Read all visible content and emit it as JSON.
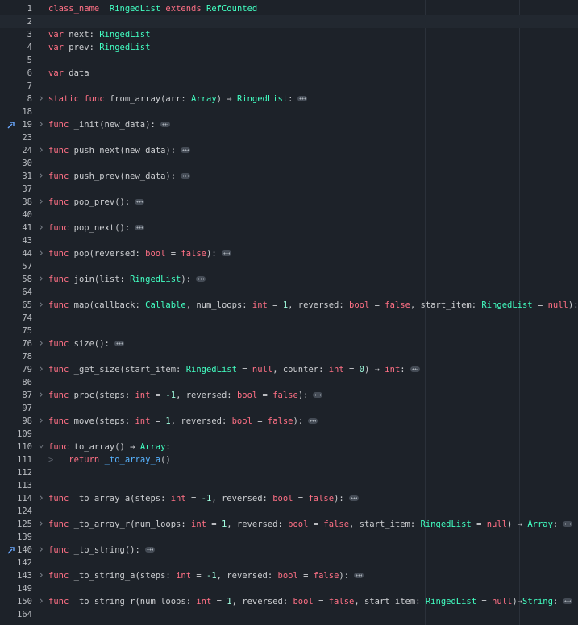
{
  "editor": {
    "colors": {
      "background": "#1d2229",
      "keyword": "#ff7085",
      "type": "#42ffc2",
      "line_number": "#b9bcc1",
      "function_call": "#57b3ff",
      "current_line": "#222830"
    },
    "lines": [
      {
        "n": "1",
        "segs": [
          [
            "class_name",
            "kw"
          ],
          [
            "  ",
            "plain"
          ],
          [
            "RingedList",
            "type"
          ],
          [
            " ",
            "plain"
          ],
          [
            "extends",
            "kw"
          ],
          [
            " ",
            "plain"
          ],
          [
            "RefCounted",
            "type"
          ]
        ]
      },
      {
        "n": "2",
        "segs": [],
        "current": true
      },
      {
        "n": "3",
        "segs": [
          [
            "var",
            "kw"
          ],
          [
            " next: ",
            "plain"
          ],
          [
            "RingedList",
            "type"
          ]
        ]
      },
      {
        "n": "4",
        "segs": [
          [
            "var",
            "kw"
          ],
          [
            " prev: ",
            "plain"
          ],
          [
            "RingedList",
            "type"
          ]
        ]
      },
      {
        "n": "5",
        "segs": []
      },
      {
        "n": "6",
        "segs": [
          [
            "var",
            "kw"
          ],
          [
            " data",
            "plain"
          ]
        ]
      },
      {
        "n": "7",
        "segs": []
      },
      {
        "n": "8",
        "fold": "closed",
        "ellip": true,
        "segs": [
          [
            "static",
            "kw"
          ],
          [
            " ",
            "plain"
          ],
          [
            "func",
            "kw"
          ],
          [
            " from_array(arr: ",
            "plain"
          ],
          [
            "Array",
            "type"
          ],
          [
            ") → ",
            "plain"
          ],
          [
            "RingedList",
            "type"
          ],
          [
            ":",
            "plain"
          ]
        ]
      },
      {
        "n": "18",
        "segs": []
      },
      {
        "n": "19",
        "fold": "closed",
        "ellip": true,
        "override": true,
        "segs": [
          [
            "func",
            "kw"
          ],
          [
            " _init(new_data):",
            "plain"
          ]
        ]
      },
      {
        "n": "23",
        "segs": []
      },
      {
        "n": "24",
        "fold": "closed",
        "ellip": true,
        "segs": [
          [
            "func",
            "kw"
          ],
          [
            " push_next(new_data):",
            "plain"
          ]
        ]
      },
      {
        "n": "30",
        "segs": []
      },
      {
        "n": "31",
        "fold": "closed",
        "ellip": true,
        "segs": [
          [
            "func",
            "kw"
          ],
          [
            " push_prev(new_data):",
            "plain"
          ]
        ]
      },
      {
        "n": "37",
        "segs": []
      },
      {
        "n": "38",
        "fold": "closed",
        "ellip": true,
        "segs": [
          [
            "func",
            "kw"
          ],
          [
            " pop_prev():",
            "plain"
          ]
        ]
      },
      {
        "n": "40",
        "segs": []
      },
      {
        "n": "41",
        "fold": "closed",
        "ellip": true,
        "segs": [
          [
            "func",
            "kw"
          ],
          [
            " pop_next():",
            "plain"
          ]
        ]
      },
      {
        "n": "43",
        "segs": []
      },
      {
        "n": "44",
        "fold": "closed",
        "ellip": true,
        "segs": [
          [
            "func",
            "kw"
          ],
          [
            " pop(reversed: ",
            "plain"
          ],
          [
            "bool",
            "kw"
          ],
          [
            " = ",
            "plain"
          ],
          [
            "false",
            "kw"
          ],
          [
            "):",
            "plain"
          ]
        ]
      },
      {
        "n": "57",
        "segs": []
      },
      {
        "n": "58",
        "fold": "closed",
        "ellip": true,
        "segs": [
          [
            "func",
            "kw"
          ],
          [
            " join(list: ",
            "plain"
          ],
          [
            "RingedList",
            "type"
          ],
          [
            "):",
            "plain"
          ]
        ]
      },
      {
        "n": "64",
        "segs": []
      },
      {
        "n": "65",
        "fold": "closed",
        "ellip": true,
        "segs": [
          [
            "func",
            "kw"
          ],
          [
            " map(callback: ",
            "plain"
          ],
          [
            "Callable",
            "type"
          ],
          [
            ", num_loops: ",
            "plain"
          ],
          [
            "int",
            "kw"
          ],
          [
            " = ",
            "plain"
          ],
          [
            "1",
            "num"
          ],
          [
            ", reversed: ",
            "plain"
          ],
          [
            "bool",
            "kw"
          ],
          [
            " = ",
            "plain"
          ],
          [
            "false",
            "kw"
          ],
          [
            ", start_item: ",
            "plain"
          ],
          [
            "RingedList",
            "type"
          ],
          [
            " = ",
            "plain"
          ],
          [
            "null",
            "kw"
          ],
          [
            "):",
            "plain"
          ]
        ]
      },
      {
        "n": "74",
        "segs": []
      },
      {
        "n": "75",
        "segs": []
      },
      {
        "n": "76",
        "fold": "closed",
        "ellip": true,
        "segs": [
          [
            "func",
            "kw"
          ],
          [
            " size():",
            "plain"
          ]
        ]
      },
      {
        "n": "78",
        "segs": []
      },
      {
        "n": "79",
        "fold": "closed",
        "ellip": true,
        "segs": [
          [
            "func",
            "kw"
          ],
          [
            " _get_size(start_item: ",
            "plain"
          ],
          [
            "RingedList",
            "type"
          ],
          [
            " = ",
            "plain"
          ],
          [
            "null",
            "kw"
          ],
          [
            ", counter: ",
            "plain"
          ],
          [
            "int",
            "kw"
          ],
          [
            " = ",
            "plain"
          ],
          [
            "0",
            "num"
          ],
          [
            ") → ",
            "plain"
          ],
          [
            "int",
            "kw"
          ],
          [
            ":",
            "plain"
          ]
        ]
      },
      {
        "n": "86",
        "segs": []
      },
      {
        "n": "87",
        "fold": "closed",
        "ellip": true,
        "segs": [
          [
            "func",
            "kw"
          ],
          [
            " proc(steps: ",
            "plain"
          ],
          [
            "int",
            "kw"
          ],
          [
            " = ",
            "plain"
          ],
          [
            "-1",
            "num"
          ],
          [
            ", reversed: ",
            "plain"
          ],
          [
            "bool",
            "kw"
          ],
          [
            " = ",
            "plain"
          ],
          [
            "false",
            "kw"
          ],
          [
            "):",
            "plain"
          ]
        ]
      },
      {
        "n": "97",
        "segs": []
      },
      {
        "n": "98",
        "fold": "closed",
        "ellip": true,
        "segs": [
          [
            "func",
            "kw"
          ],
          [
            " move(steps: ",
            "plain"
          ],
          [
            "int",
            "kw"
          ],
          [
            " = ",
            "plain"
          ],
          [
            "1",
            "num"
          ],
          [
            ", reversed: ",
            "plain"
          ],
          [
            "bool",
            "kw"
          ],
          [
            " = ",
            "plain"
          ],
          [
            "false",
            "kw"
          ],
          [
            "):",
            "plain"
          ]
        ]
      },
      {
        "n": "109",
        "segs": []
      },
      {
        "n": "110",
        "fold": "open",
        "segs": [
          [
            "func",
            "kw"
          ],
          [
            " to_array() → ",
            "plain"
          ],
          [
            "Array",
            "type"
          ],
          [
            ":",
            "plain"
          ]
        ]
      },
      {
        "n": "111",
        "tab": true,
        "segs": [
          [
            "return",
            "kw"
          ],
          [
            " ",
            "plain"
          ],
          [
            "_to_array_a",
            "func"
          ],
          [
            "()",
            "plain"
          ]
        ]
      },
      {
        "n": "112",
        "segs": []
      },
      {
        "n": "113",
        "segs": []
      },
      {
        "n": "114",
        "fold": "closed",
        "ellip": true,
        "segs": [
          [
            "func",
            "kw"
          ],
          [
            " _to_array_a(steps: ",
            "plain"
          ],
          [
            "int",
            "kw"
          ],
          [
            " = ",
            "plain"
          ],
          [
            "-1",
            "num"
          ],
          [
            ", reversed: ",
            "plain"
          ],
          [
            "bool",
            "kw"
          ],
          [
            " = ",
            "plain"
          ],
          [
            "false",
            "kw"
          ],
          [
            "):",
            "plain"
          ]
        ]
      },
      {
        "n": "124",
        "segs": []
      },
      {
        "n": "125",
        "fold": "closed",
        "ellip": true,
        "segs": [
          [
            "func",
            "kw"
          ],
          [
            " _to_array_r(num_loops: ",
            "plain"
          ],
          [
            "int",
            "kw"
          ],
          [
            " = ",
            "plain"
          ],
          [
            "1",
            "num"
          ],
          [
            ", reversed: ",
            "plain"
          ],
          [
            "bool",
            "kw"
          ],
          [
            " = ",
            "plain"
          ],
          [
            "false",
            "kw"
          ],
          [
            ", start_item: ",
            "plain"
          ],
          [
            "RingedList",
            "type"
          ],
          [
            " = ",
            "plain"
          ],
          [
            "null",
            "kw"
          ],
          [
            ") → ",
            "plain"
          ],
          [
            "Array",
            "type"
          ],
          [
            ":",
            "plain"
          ]
        ]
      },
      {
        "n": "139",
        "segs": []
      },
      {
        "n": "140",
        "fold": "closed",
        "ellip": true,
        "override": true,
        "segs": [
          [
            "func",
            "kw"
          ],
          [
            " _to_string():",
            "plain"
          ]
        ]
      },
      {
        "n": "142",
        "segs": []
      },
      {
        "n": "143",
        "fold": "closed",
        "ellip": true,
        "segs": [
          [
            "func",
            "kw"
          ],
          [
            " _to_string_a(steps: ",
            "plain"
          ],
          [
            "int",
            "kw"
          ],
          [
            " = ",
            "plain"
          ],
          [
            "-1",
            "num"
          ],
          [
            ", reversed: ",
            "plain"
          ],
          [
            "bool",
            "kw"
          ],
          [
            " = ",
            "plain"
          ],
          [
            "false",
            "kw"
          ],
          [
            "):",
            "plain"
          ]
        ]
      },
      {
        "n": "149",
        "segs": []
      },
      {
        "n": "150",
        "fold": "closed",
        "ellip": true,
        "segs": [
          [
            "func",
            "kw"
          ],
          [
            " _to_string_r(num_loops: ",
            "plain"
          ],
          [
            "int",
            "kw"
          ],
          [
            " = ",
            "plain"
          ],
          [
            "1",
            "num"
          ],
          [
            ", reversed: ",
            "plain"
          ],
          [
            "bool",
            "kw"
          ],
          [
            " = ",
            "plain"
          ],
          [
            "false",
            "kw"
          ],
          [
            ", start_item: ",
            "plain"
          ],
          [
            "RingedList",
            "type"
          ],
          [
            " = ",
            "plain"
          ],
          [
            "null",
            "kw"
          ],
          [
            ")→",
            "plain"
          ],
          [
            "String",
            "type"
          ],
          [
            ":",
            "plain"
          ]
        ]
      },
      {
        "n": "164",
        "segs": []
      }
    ]
  }
}
